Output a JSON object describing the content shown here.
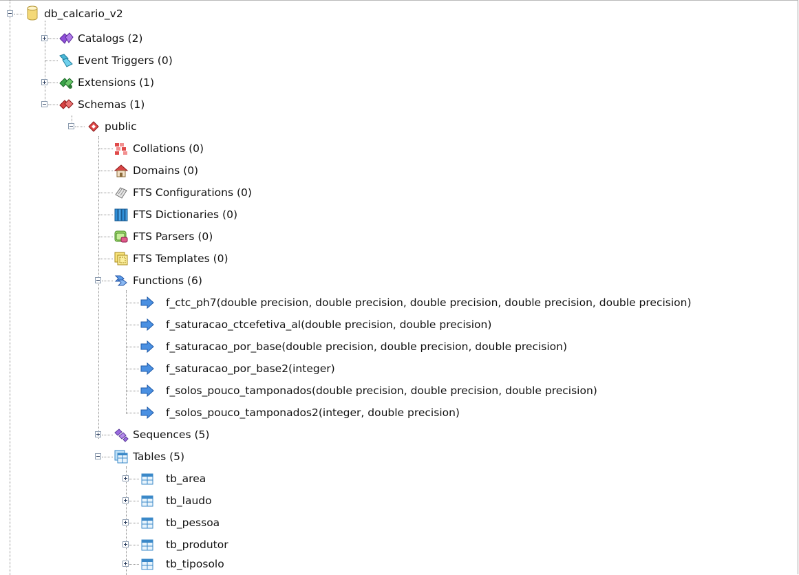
{
  "tree": {
    "database": "db_calcario_v2",
    "catalogs": "Catalogs (2)",
    "event_triggers": "Event Triggers (0)",
    "extensions": "Extensions (1)",
    "schemas": "Schemas (1)",
    "schema_public": "public",
    "collations": "Collations (0)",
    "domains": "Domains (0)",
    "fts_configurations": "FTS Configurations (0)",
    "fts_dictionaries": "FTS Dictionaries (0)",
    "fts_parsers": "FTS Parsers (0)",
    "fts_templates": "FTS Templates (0)",
    "functions": "Functions (6)",
    "function_items": [
      "f_ctc_ph7(double precision, double precision, double precision, double precision, double precision)",
      "f_saturacao_ctcefetiva_al(double precision, double precision)",
      "f_saturacao_por_base(double precision, double precision, double precision)",
      "f_saturacao_por_base2(integer)",
      "f_solos_pouco_tamponados(double precision, double precision, double precision)",
      "f_solos_pouco_tamponados2(integer, double precision)"
    ],
    "sequences": "Sequences (5)",
    "tables": "Tables (5)",
    "table_items": [
      "tb_area",
      "tb_laudo",
      "tb_pessoa",
      "tb_produtor",
      "tb_tiposolo"
    ]
  },
  "icons": {
    "database": "database-icon",
    "catalogs": "catalogs-icon",
    "event_triggers": "event-triggers-icon",
    "extensions": "extensions-icon",
    "schemas": "schemas-icon",
    "schema": "schema-icon",
    "collations": "collations-icon",
    "domains": "domains-icon",
    "fts_configurations": "fts-configurations-icon",
    "fts_dictionaries": "fts-dictionaries-icon",
    "fts_parsers": "fts-parsers-icon",
    "fts_templates": "fts-templates-icon",
    "functions": "functions-icon",
    "function": "function-icon",
    "sequences": "sequences-icon",
    "tables": "tables-icon",
    "table": "table-icon"
  }
}
